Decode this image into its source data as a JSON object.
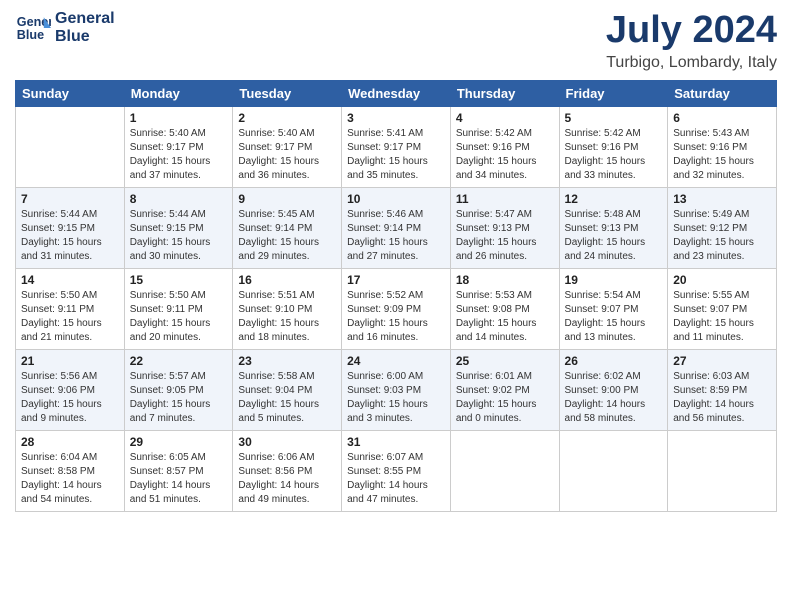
{
  "logo": {
    "line1": "General",
    "line2": "Blue"
  },
  "title": "July 2024",
  "subtitle": "Turbigo, Lombardy, Italy",
  "header": {
    "days": [
      "Sunday",
      "Monday",
      "Tuesday",
      "Wednesday",
      "Thursday",
      "Friday",
      "Saturday"
    ]
  },
  "weeks": [
    [
      {
        "num": "",
        "info": ""
      },
      {
        "num": "1",
        "info": "Sunrise: 5:40 AM\nSunset: 9:17 PM\nDaylight: 15 hours\nand 37 minutes."
      },
      {
        "num": "2",
        "info": "Sunrise: 5:40 AM\nSunset: 9:17 PM\nDaylight: 15 hours\nand 36 minutes."
      },
      {
        "num": "3",
        "info": "Sunrise: 5:41 AM\nSunset: 9:17 PM\nDaylight: 15 hours\nand 35 minutes."
      },
      {
        "num": "4",
        "info": "Sunrise: 5:42 AM\nSunset: 9:16 PM\nDaylight: 15 hours\nand 34 minutes."
      },
      {
        "num": "5",
        "info": "Sunrise: 5:42 AM\nSunset: 9:16 PM\nDaylight: 15 hours\nand 33 minutes."
      },
      {
        "num": "6",
        "info": "Sunrise: 5:43 AM\nSunset: 9:16 PM\nDaylight: 15 hours\nand 32 minutes."
      }
    ],
    [
      {
        "num": "7",
        "info": "Sunrise: 5:44 AM\nSunset: 9:15 PM\nDaylight: 15 hours\nand 31 minutes."
      },
      {
        "num": "8",
        "info": "Sunrise: 5:44 AM\nSunset: 9:15 PM\nDaylight: 15 hours\nand 30 minutes."
      },
      {
        "num": "9",
        "info": "Sunrise: 5:45 AM\nSunset: 9:14 PM\nDaylight: 15 hours\nand 29 minutes."
      },
      {
        "num": "10",
        "info": "Sunrise: 5:46 AM\nSunset: 9:14 PM\nDaylight: 15 hours\nand 27 minutes."
      },
      {
        "num": "11",
        "info": "Sunrise: 5:47 AM\nSunset: 9:13 PM\nDaylight: 15 hours\nand 26 minutes."
      },
      {
        "num": "12",
        "info": "Sunrise: 5:48 AM\nSunset: 9:13 PM\nDaylight: 15 hours\nand 24 minutes."
      },
      {
        "num": "13",
        "info": "Sunrise: 5:49 AM\nSunset: 9:12 PM\nDaylight: 15 hours\nand 23 minutes."
      }
    ],
    [
      {
        "num": "14",
        "info": "Sunrise: 5:50 AM\nSunset: 9:11 PM\nDaylight: 15 hours\nand 21 minutes."
      },
      {
        "num": "15",
        "info": "Sunrise: 5:50 AM\nSunset: 9:11 PM\nDaylight: 15 hours\nand 20 minutes."
      },
      {
        "num": "16",
        "info": "Sunrise: 5:51 AM\nSunset: 9:10 PM\nDaylight: 15 hours\nand 18 minutes."
      },
      {
        "num": "17",
        "info": "Sunrise: 5:52 AM\nSunset: 9:09 PM\nDaylight: 15 hours\nand 16 minutes."
      },
      {
        "num": "18",
        "info": "Sunrise: 5:53 AM\nSunset: 9:08 PM\nDaylight: 15 hours\nand 14 minutes."
      },
      {
        "num": "19",
        "info": "Sunrise: 5:54 AM\nSunset: 9:07 PM\nDaylight: 15 hours\nand 13 minutes."
      },
      {
        "num": "20",
        "info": "Sunrise: 5:55 AM\nSunset: 9:07 PM\nDaylight: 15 hours\nand 11 minutes."
      }
    ],
    [
      {
        "num": "21",
        "info": "Sunrise: 5:56 AM\nSunset: 9:06 PM\nDaylight: 15 hours\nand 9 minutes."
      },
      {
        "num": "22",
        "info": "Sunrise: 5:57 AM\nSunset: 9:05 PM\nDaylight: 15 hours\nand 7 minutes."
      },
      {
        "num": "23",
        "info": "Sunrise: 5:58 AM\nSunset: 9:04 PM\nDaylight: 15 hours\nand 5 minutes."
      },
      {
        "num": "24",
        "info": "Sunrise: 6:00 AM\nSunset: 9:03 PM\nDaylight: 15 hours\nand 3 minutes."
      },
      {
        "num": "25",
        "info": "Sunrise: 6:01 AM\nSunset: 9:02 PM\nDaylight: 15 hours\nand 0 minutes."
      },
      {
        "num": "26",
        "info": "Sunrise: 6:02 AM\nSunset: 9:00 PM\nDaylight: 14 hours\nand 58 minutes."
      },
      {
        "num": "27",
        "info": "Sunrise: 6:03 AM\nSunset: 8:59 PM\nDaylight: 14 hours\nand 56 minutes."
      }
    ],
    [
      {
        "num": "28",
        "info": "Sunrise: 6:04 AM\nSunset: 8:58 PM\nDaylight: 14 hours\nand 54 minutes."
      },
      {
        "num": "29",
        "info": "Sunrise: 6:05 AM\nSunset: 8:57 PM\nDaylight: 14 hours\nand 51 minutes."
      },
      {
        "num": "30",
        "info": "Sunrise: 6:06 AM\nSunset: 8:56 PM\nDaylight: 14 hours\nand 49 minutes."
      },
      {
        "num": "31",
        "info": "Sunrise: 6:07 AM\nSunset: 8:55 PM\nDaylight: 14 hours\nand 47 minutes."
      },
      {
        "num": "",
        "info": ""
      },
      {
        "num": "",
        "info": ""
      },
      {
        "num": "",
        "info": ""
      }
    ]
  ]
}
